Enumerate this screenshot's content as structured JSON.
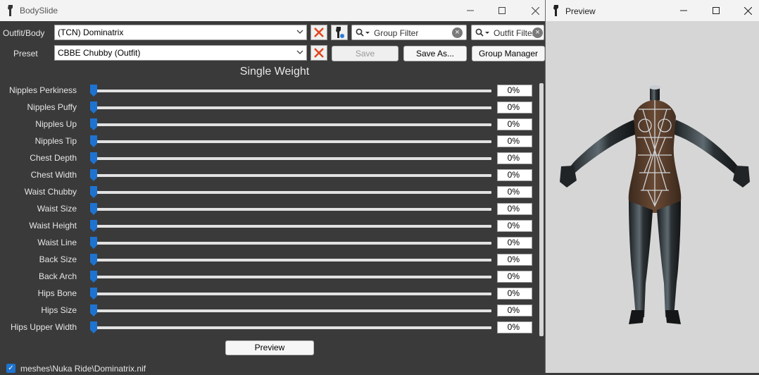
{
  "main_window": {
    "title": "BodySlide",
    "outfit_label": "Outfit/Body",
    "outfit_value": "(TCN) Dominatrix",
    "preset_label": "Preset",
    "preset_value": "CBBE Chubby (Outfit)",
    "group_filter_placeholder": "Group Filter",
    "outfit_filter_placeholder": "Outfit Filter",
    "save_label": "Save",
    "save_as_label": "Save As...",
    "group_manager_label": "Group Manager",
    "section_title": "Single Weight",
    "preview_button_label": "Preview",
    "file_path": "meshes\\Nuka Ride\\Dominatrix.nif",
    "file_checked": true
  },
  "sliders": [
    {
      "label": "Nipples Perkiness",
      "value": "0%",
      "level": 0
    },
    {
      "label": "Nipples Puffy",
      "value": "0%",
      "level": 0
    },
    {
      "label": "Nipples Up",
      "value": "0%",
      "level": 0
    },
    {
      "label": "Nipples Tip",
      "value": "0%",
      "level": 0
    },
    {
      "label": "Chest Depth",
      "value": "0%",
      "level": 0
    },
    {
      "label": "Chest Width",
      "value": "0%",
      "level": 0
    },
    {
      "label": "Waist Chubby",
      "value": "0%",
      "level": 0
    },
    {
      "label": "Waist Size",
      "value": "0%",
      "level": 0
    },
    {
      "label": "Waist Height",
      "value": "0%",
      "level": 0
    },
    {
      "label": "Waist Line",
      "value": "0%",
      "level": 0
    },
    {
      "label": "Back Size",
      "value": "0%",
      "level": 0
    },
    {
      "label": "Back Arch",
      "value": "0%",
      "level": 0
    },
    {
      "label": "Hips Bone",
      "value": "0%",
      "level": 0
    },
    {
      "label": "Hips Size",
      "value": "0%",
      "level": 0
    },
    {
      "label": "Hips Upper Width",
      "value": "0%",
      "level": 0
    }
  ],
  "preview_window": {
    "title": "Preview"
  },
  "colors": {
    "accent": "#1e73d0",
    "background": "#3a3a3a",
    "clear_x": "#e0441b"
  },
  "icons": [
    "app-icon",
    "minimize-icon",
    "maximize-icon",
    "close-icon",
    "chevron-down-icon",
    "clear-x-icon",
    "outfit-studio-icon",
    "search-icon",
    "clear-icon",
    "checkbox-icon"
  ]
}
